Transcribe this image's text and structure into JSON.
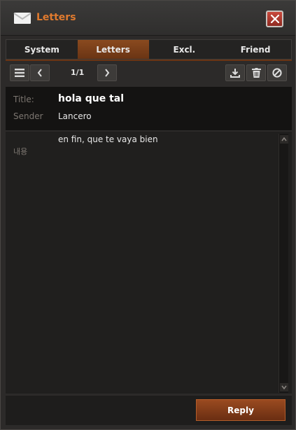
{
  "window": {
    "title": "Letters",
    "icon": "envelope-icon",
    "accent_color": "#e07a2e"
  },
  "tabs": [
    {
      "label": "System",
      "active": false
    },
    {
      "label": "Letters",
      "active": true
    },
    {
      "label": "Excl.",
      "active": false
    },
    {
      "label": "Friend",
      "active": false
    }
  ],
  "toolbar": {
    "pager": "1/1",
    "icons": [
      "menu-icon",
      "chevron-left-icon",
      "chevron-right-icon",
      "download-icon",
      "trash-icon",
      "block-icon"
    ]
  },
  "letter": {
    "title_label": "Title:",
    "title_value": "hola que tal",
    "sender_label": "Sender",
    "sender_value": "Lancero",
    "content_label": "내용",
    "content_value": "en fin, que te vaya bien"
  },
  "footer": {
    "reply_label": "Reply"
  }
}
